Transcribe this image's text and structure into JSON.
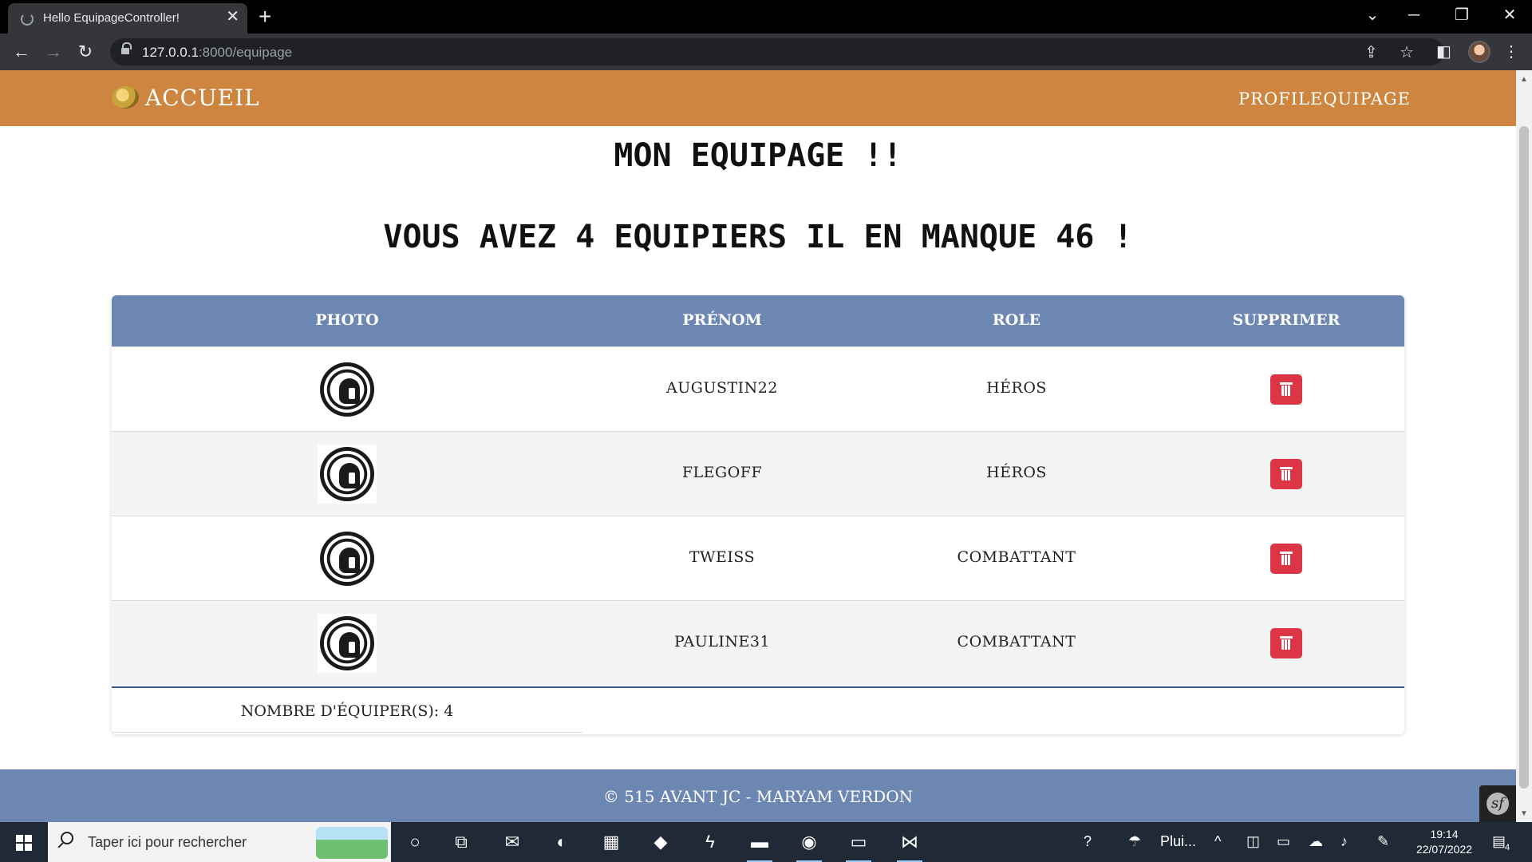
{
  "browser": {
    "tab_title": "Hello EquipageController!",
    "tab_close": "✕",
    "new_tab": "+",
    "url_host": "127.0.0.1",
    "url_path": ":8000/equipage"
  },
  "site_nav": {
    "brand": "ACCUEIL",
    "links": [
      "PROFIL",
      "EQUIPAGE"
    ]
  },
  "headings": {
    "title": "MON EQUIPAGE !!",
    "subtitle": "VOUS AVEZ 4 EQUIPIERS IL EN MANQUE 46 !"
  },
  "table": {
    "columns": [
      "PHOTO",
      "PRÉNOM",
      "ROLE",
      "SUPPRIMER"
    ],
    "rows": [
      {
        "prenom": "AUGUSTIN22",
        "role": "HÉROS"
      },
      {
        "prenom": "FLEGOFF",
        "role": "HÉROS"
      },
      {
        "prenom": "TWEISS",
        "role": "COMBATTANT"
      },
      {
        "prenom": "PAULINE31",
        "role": "COMBATTANT"
      }
    ],
    "footer": "NOMBRE D'ÉQUIPER(S): 4"
  },
  "footer": {
    "text": "© 515 AVANT JC - MARYAM VERDON"
  },
  "symfony_badge": "sf",
  "taskbar": {
    "search_placeholder": "Taper ici pour rechercher",
    "weather": "Plui...",
    "time": "19:14",
    "date": "22/07/2022",
    "notifications": "4"
  },
  "colors": {
    "nav_bg": "#cd853f",
    "table_header_bg": "#6d87b3",
    "footer_bg": "#6d87b3",
    "delete_button": "#dc3545"
  }
}
